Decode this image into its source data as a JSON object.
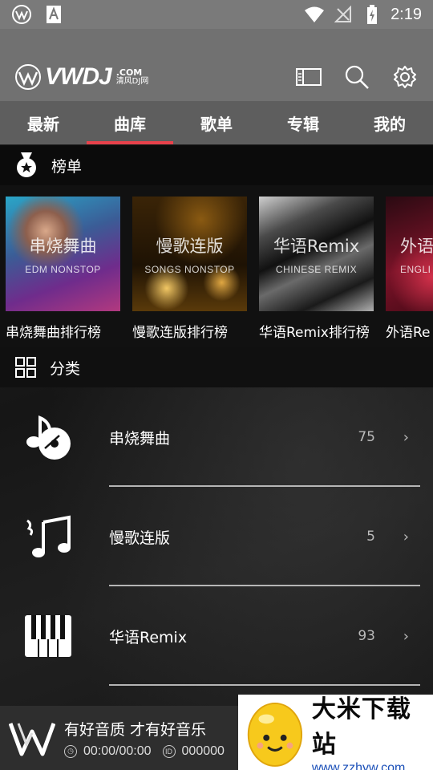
{
  "status_bar": {
    "time": "2:19",
    "icons": [
      "app-w-icon",
      "font-a-icon",
      "wifi-icon",
      "no-signal-icon",
      "battery-charging-icon"
    ]
  },
  "header": {
    "logo_text": "VWDJ",
    "logo_domain": ".COM",
    "logo_sub": "清风DJ网",
    "icons": [
      "playlist-icon",
      "search-icon",
      "settings-icon"
    ]
  },
  "tabs": [
    {
      "label": "最新",
      "active": false
    },
    {
      "label": "曲库",
      "active": true
    },
    {
      "label": "歌单",
      "active": false
    },
    {
      "label": "专辑",
      "active": false
    },
    {
      "label": "我的",
      "active": false
    }
  ],
  "charts_section": {
    "title": "榜单",
    "items": [
      {
        "cover_title": "串烧舞曲",
        "cover_subtitle": "EDM NONSTOP",
        "label": "串烧舞曲排行榜"
      },
      {
        "cover_title": "慢歌连版",
        "cover_subtitle": "SONGS NONSTOP",
        "label": "慢歌连版排行榜"
      },
      {
        "cover_title": "华语Remix",
        "cover_subtitle": "CHINESE REMIX",
        "label": "华语Remix排行榜"
      },
      {
        "cover_title": "外语",
        "cover_subtitle": "ENGLI",
        "label": "外语Re"
      }
    ]
  },
  "category_section": {
    "title": "分类",
    "items": [
      {
        "name": "串烧舞曲",
        "count": "75",
        "icon": "music-disc-icon"
      },
      {
        "name": "慢歌连版",
        "count": "5",
        "icon": "music-notes-icon"
      },
      {
        "name": "华语Remix",
        "count": "93",
        "icon": "piano-keys-icon"
      }
    ]
  },
  "player": {
    "title": "有好音质 才有好音乐",
    "time": "00:00/00:00",
    "id": "000000"
  },
  "watermark": {
    "title": "大米下载站",
    "url": "www.zzhyw.com"
  }
}
